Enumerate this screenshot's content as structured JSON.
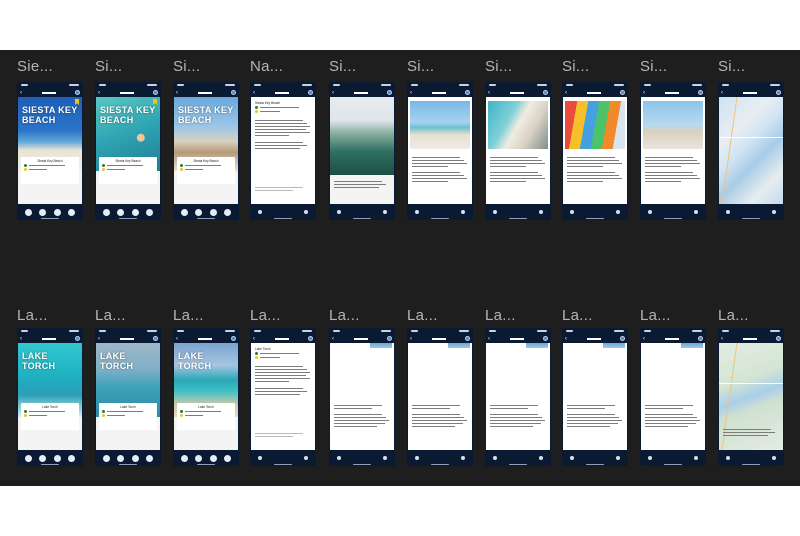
{
  "canvas": {
    "background": "#1e1e1e",
    "page_background": "#ffffff"
  },
  "theme": {
    "phone_bg": "#0b1a33",
    "accent_yellow": "#f0c419",
    "pin_green": "#2b7a3a",
    "label_color": "#b5b5b5"
  },
  "rows": [
    {
      "frames": [
        {
          "label": "Sie...",
          "kind": "hero",
          "hero": "siesta-beach",
          "title": "SIESTA KEY BEACH",
          "card_title": "Siesta Key Beach",
          "bookmark": true
        },
        {
          "label": "Si...",
          "kind": "hero",
          "hero": "siesta-swimmer",
          "title": "SIESTA KEY BEACH",
          "card_title": "Siesta Key Beach",
          "bookmark": true
        },
        {
          "label": "Si...",
          "kind": "hero",
          "hero": "siesta-boardwalk",
          "title": "SIESTA KEY BEACH",
          "card_title": "Siesta Key Beach",
          "bookmark": false
        },
        {
          "label": "Na...",
          "kind": "detail",
          "card_title": "Siesta Key Beach"
        },
        {
          "label": "Si...",
          "kind": "photo-sheet",
          "hero": "siesta-aerial"
        },
        {
          "label": "Si...",
          "kind": "photo-text",
          "hero": "siesta-crowd"
        },
        {
          "label": "Si...",
          "kind": "photo-text",
          "hero": "siesta-coast"
        },
        {
          "label": "Si...",
          "kind": "photo-text",
          "hero": "siesta-kayaks"
        },
        {
          "label": "Si...",
          "kind": "photo-text",
          "hero": "siesta-bikes"
        },
        {
          "label": "Si...",
          "kind": "map",
          "hero": "siesta-map"
        }
      ]
    },
    {
      "frames": [
        {
          "label": "La...",
          "kind": "hero",
          "hero": "lake-aerial",
          "title": "LAKE TORCH",
          "card_title": "Lake Torch",
          "bookmark": false
        },
        {
          "label": "La...",
          "kind": "hero",
          "hero": "lake-boat",
          "title": "LAKE TORCH",
          "card_title": "Lake Torch",
          "bookmark": false
        },
        {
          "label": "La...",
          "kind": "hero",
          "hero": "lake-shore",
          "title": "LAKE TORCH",
          "card_title": "Lake Torch",
          "bookmark": false
        },
        {
          "label": "La...",
          "kind": "detail",
          "card_title": "Lake Torch"
        },
        {
          "label": "La...",
          "kind": "blank-text",
          "hero": "lake-thumb"
        },
        {
          "label": "La...",
          "kind": "blank-text",
          "hero": "lake-thumb"
        },
        {
          "label": "La...",
          "kind": "blank-text",
          "hero": "lake-thumb"
        },
        {
          "label": "La...",
          "kind": "blank-text",
          "hero": "lake-thumb"
        },
        {
          "label": "La...",
          "kind": "blank-text",
          "hero": "lake-thumb"
        },
        {
          "label": "La...",
          "kind": "map",
          "hero": "lake-map"
        }
      ]
    }
  ]
}
